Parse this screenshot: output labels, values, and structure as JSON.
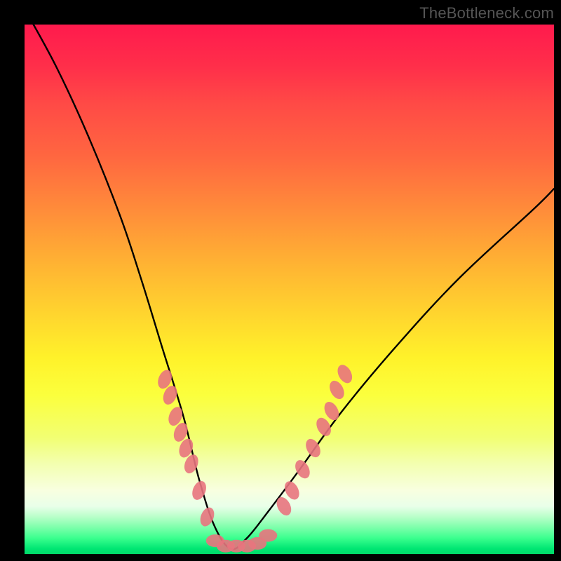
{
  "attribution": "TheBottleneck.com",
  "chart_data": {
    "type": "line",
    "title": "",
    "xlabel": "",
    "ylabel": "",
    "xlim": [
      0,
      100
    ],
    "ylim": [
      0,
      100
    ],
    "grid": false,
    "legend": false,
    "series": [
      {
        "name": "bottleneck-curve",
        "description": "V-shaped curve, minimum near x≈39",
        "x": [
          0,
          6,
          12,
          18,
          22,
          26,
          30,
          33,
          36,
          39,
          42,
          46,
          52,
          60,
          70,
          82,
          96,
          100
        ],
        "y": [
          103,
          92,
          79,
          64,
          52,
          39,
          26,
          14,
          5,
          1,
          3,
          8,
          16,
          27,
          39,
          52,
          65,
          69
        ]
      },
      {
        "name": "left-marker-cluster",
        "type": "scatter",
        "description": "Pink elongated markers along left descending arm",
        "points": [
          {
            "x": 26.5,
            "y": 33
          },
          {
            "x": 27.5,
            "y": 30
          },
          {
            "x": 28.5,
            "y": 26
          },
          {
            "x": 29.5,
            "y": 23
          },
          {
            "x": 30.5,
            "y": 20
          },
          {
            "x": 31.5,
            "y": 17
          },
          {
            "x": 33.0,
            "y": 12
          },
          {
            "x": 34.5,
            "y": 7
          }
        ]
      },
      {
        "name": "bottom-marker-cluster",
        "type": "scatter",
        "description": "Pink elongated markers along flat valley bottom",
        "points": [
          {
            "x": 36.0,
            "y": 2.5
          },
          {
            "x": 38.0,
            "y": 1.5
          },
          {
            "x": 40.0,
            "y": 1.5
          },
          {
            "x": 42.0,
            "y": 1.5
          },
          {
            "x": 44.0,
            "y": 2.0
          },
          {
            "x": 46.0,
            "y": 3.5
          }
        ]
      },
      {
        "name": "right-marker-cluster",
        "type": "scatter",
        "description": "Pink elongated markers along right ascending arm",
        "points": [
          {
            "x": 49.0,
            "y": 9
          },
          {
            "x": 50.5,
            "y": 12
          },
          {
            "x": 52.5,
            "y": 16
          },
          {
            "x": 54.5,
            "y": 20
          },
          {
            "x": 56.5,
            "y": 24
          },
          {
            "x": 58.0,
            "y": 27
          },
          {
            "x": 59.0,
            "y": 31
          },
          {
            "x": 60.5,
            "y": 34
          }
        ]
      }
    ]
  }
}
